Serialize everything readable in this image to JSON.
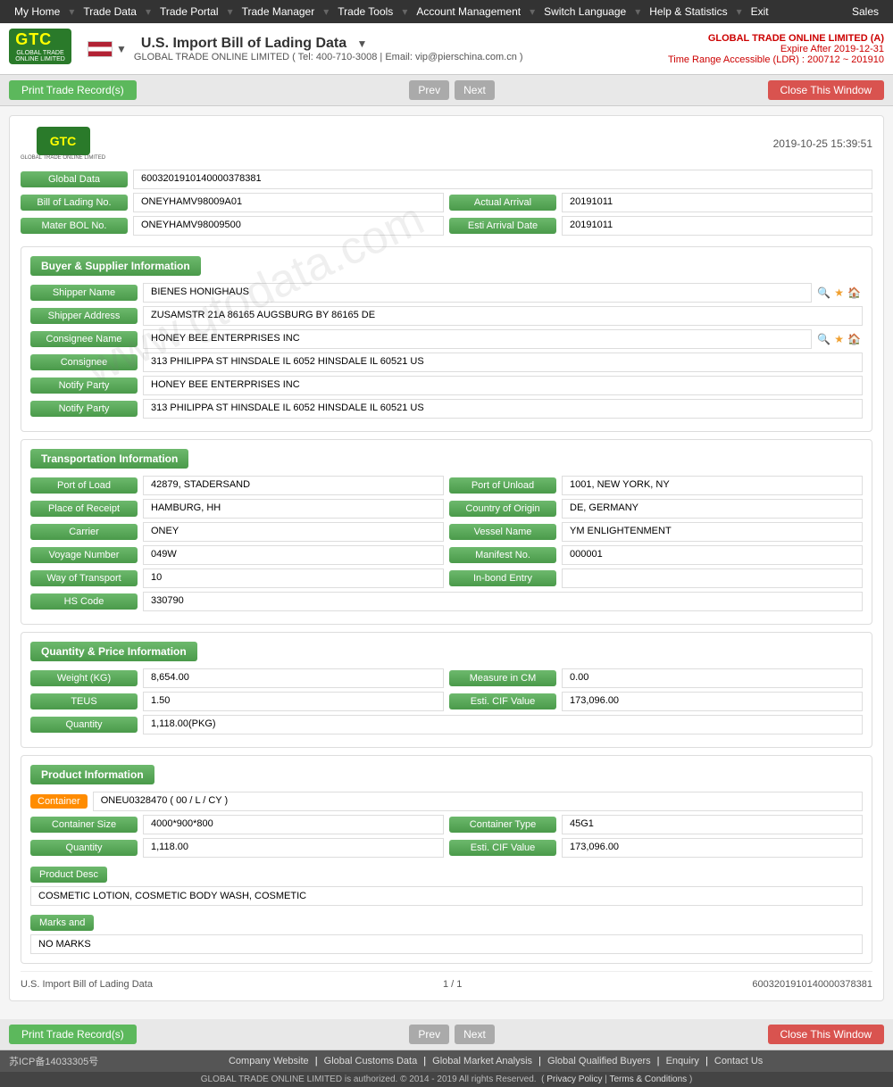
{
  "topnav": {
    "items": [
      "My Home",
      "Trade Data",
      "Trade Portal",
      "Trade Manager",
      "Trade Tools",
      "Account Management",
      "Switch Language",
      "Help & Statistics",
      "Exit"
    ],
    "sales": "Sales"
  },
  "header": {
    "title": "U.S. Import Bill of Lading Data",
    "company_name": "GLOBAL TRADE ONLINE LIMITED (A)",
    "expire": "Expire After 2019-12-31",
    "time_range": "Time Range Accessible (LDR) : 200712 ~ 201910",
    "contact": "GLOBAL TRADE ONLINE LIMITED ( Tel: 400-710-3008 | Email: vip@pierschina.com.cn )"
  },
  "toolbar": {
    "print_label": "Print Trade Record(s)",
    "prev_label": "Prev",
    "next_label": "Next",
    "close_label": "Close This Window"
  },
  "record": {
    "timestamp": "2019-10-25 15:39:51",
    "global_data": "6003201910140000378381",
    "bill_of_lading_no": "ONEYHAMV98009A01",
    "actual_arrival": "20191011",
    "master_bol_no": "ONEYHAMV98009500",
    "esti_arrival_date": "20191011"
  },
  "buyer_supplier": {
    "title": "Buyer & Supplier Information",
    "shipper_name": "BIENES HONIGHAUS",
    "shipper_address": "ZUSAMSTR 21A 86165 AUGSBURG BY 86165 DE",
    "consignee_name": "HONEY BEE ENTERPRISES INC",
    "consignee": "313 PHILIPPA ST HINSDALE IL 6052 HINSDALE IL 60521 US",
    "notify_party1": "HONEY BEE ENTERPRISES INC",
    "notify_party2": "313 PHILIPPA ST HINSDALE IL 6052 HINSDALE IL 60521 US"
  },
  "transportation": {
    "title": "Transportation Information",
    "port_of_load": "42879, STADERSAND",
    "port_of_unload": "1001, NEW YORK, NY",
    "place_of_receipt": "HAMBURG, HH",
    "country_of_origin": "DE, GERMANY",
    "carrier": "ONEY",
    "vessel_name": "YM ENLIGHTENMENT",
    "voyage_number": "049W",
    "manifest_no": "000001",
    "way_of_transport": "10",
    "in_bond_entry": "",
    "hs_code": "330790"
  },
  "quantity_price": {
    "title": "Quantity & Price Information",
    "weight_kg": "8,654.00",
    "measure_in_cm": "0.00",
    "teus": "1.50",
    "esti_cif_value": "173,096.00",
    "quantity": "1,118.00(PKG)"
  },
  "product": {
    "title": "Product Information",
    "container": "ONEU0328470 ( 00 / L / CY )",
    "container_size": "4000*900*800",
    "container_type": "45G1",
    "quantity": "1,118.00",
    "esti_cif_value": "173,096.00",
    "product_desc_label": "Product Desc",
    "product_desc": "COSMETIC LOTION, COSMETIC BODY WASH, COSMETIC",
    "marks_label": "Marks and",
    "marks": "NO MARKS"
  },
  "record_footer": {
    "left": "U.S. Import Bill of Lading Data",
    "page": "1 / 1",
    "id": "6003201910140000378381"
  },
  "footer": {
    "icp": "苏ICP备14033305号",
    "links": [
      "Company Website",
      "Global Customs Data",
      "Global Market Analysis",
      "Global Qualified Buyers",
      "Enquiry",
      "Contact Us"
    ],
    "copyright": "GLOBAL TRADE ONLINE LIMITED is authorized. © 2014 - 2019 All rights Reserved.",
    "privacy": "Privacy Policy",
    "terms": "Terms & Conditions"
  },
  "labels": {
    "global_data": "Global Data",
    "bill_of_lading_no": "Bill of Lading No.",
    "actual_arrival": "Actual Arrival",
    "master_bol_no": "Mater BOL No.",
    "esti_arrival_date": "Esti Arrival Date",
    "shipper_name": "Shipper Name",
    "shipper_address": "Shipper Address",
    "consignee_name": "Consignee Name",
    "consignee": "Consignee",
    "notify_party": "Notify Party",
    "port_of_load": "Port of Load",
    "port_of_unload": "Port of Unload",
    "place_of_receipt": "Place of Receipt",
    "country_of_origin": "Country of Origin",
    "carrier": "Carrier",
    "vessel_name": "Vessel Name",
    "voyage_number": "Voyage Number",
    "manifest_no": "Manifest No.",
    "way_of_transport": "Way of Transport",
    "in_bond_entry": "In-bond Entry",
    "hs_code": "HS Code",
    "weight_kg": "Weight (KG)",
    "measure_in_cm": "Measure in CM",
    "teus": "TEUS",
    "esti_cif_value": "Esti. CIF Value",
    "quantity": "Quantity",
    "container": "Container",
    "container_size": "Container Size",
    "container_type": "Container Type"
  }
}
